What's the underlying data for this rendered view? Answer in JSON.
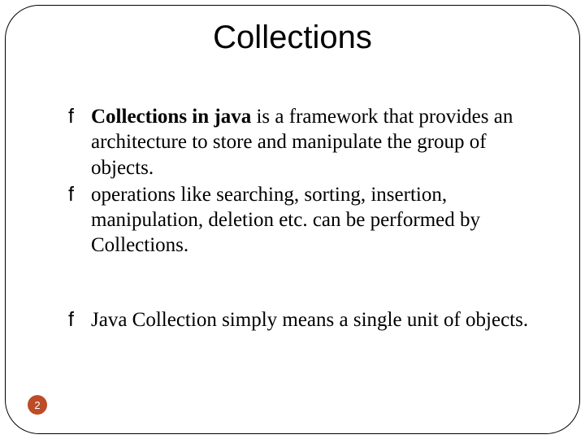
{
  "title": "Collections",
  "bullets": [
    {
      "bold": "Collections in java",
      "rest": " is a framework that provides an architecture to store and manipulate the group of objects."
    },
    {
      "bold": "",
      "rest": "operations like searching, sorting, insertion, manipulation, deletion etc. can be performed by Collections."
    },
    {
      "bold": "",
      "rest": "Java Collection simply means a single unit of objects."
    }
  ],
  "bullet_glyph": "f",
  "page_number": "2",
  "colors": {
    "accent": "#bd4c27"
  }
}
